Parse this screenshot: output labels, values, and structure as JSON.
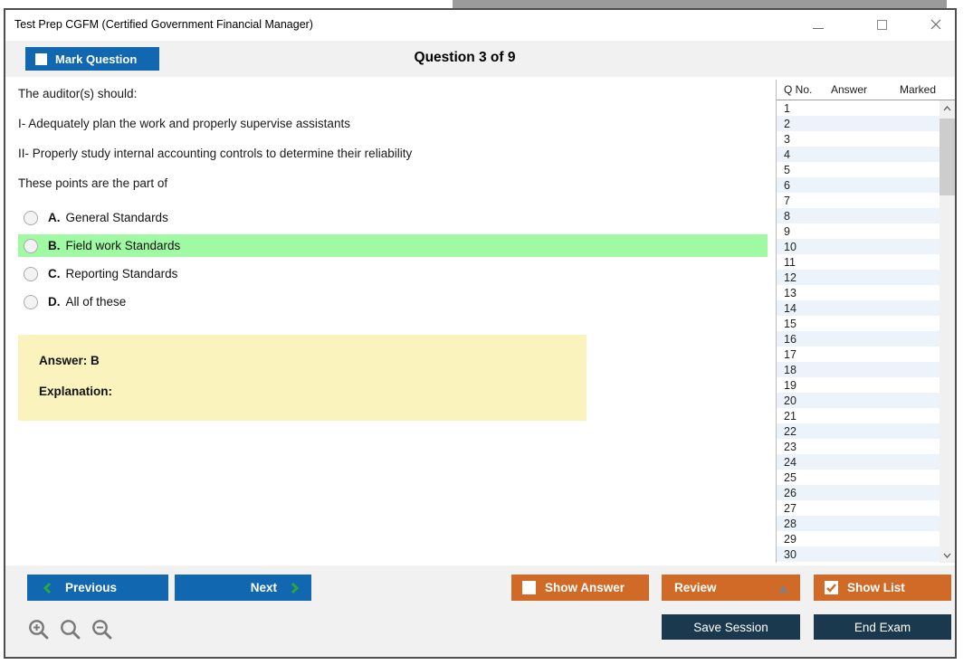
{
  "window": {
    "title": "Test Prep CGFM (Certified Government Financial Manager)"
  },
  "header": {
    "mark_question": "Mark Question",
    "mark_question_checked": false,
    "question_counter": "Question 3 of 9"
  },
  "question": {
    "lines": [
      "The auditor(s) should:",
      "I- Adequately plan the work and properly supervise assistants",
      "II- Properly study internal accounting controls to determine their reliability",
      "These points are the part of"
    ],
    "options": [
      {
        "letter": "A.",
        "text": "General Standards",
        "highlighted": false
      },
      {
        "letter": "B.",
        "text": "Field work Standards",
        "highlighted": true
      },
      {
        "letter": "C.",
        "text": "Reporting Standards",
        "highlighted": false
      },
      {
        "letter": "D.",
        "text": "All of these",
        "highlighted": false
      }
    ],
    "answer": "Answer: B",
    "explanation": "Explanation:"
  },
  "question_list": {
    "columns": [
      "Q No.",
      "Answer",
      "Marked"
    ],
    "rows": [
      {
        "q_no": "1",
        "answer": "",
        "marked": ""
      },
      {
        "q_no": "2",
        "answer": "",
        "marked": ""
      },
      {
        "q_no": "3",
        "answer": "",
        "marked": ""
      },
      {
        "q_no": "4",
        "answer": "",
        "marked": ""
      },
      {
        "q_no": "5",
        "answer": "",
        "marked": ""
      },
      {
        "q_no": "6",
        "answer": "",
        "marked": ""
      },
      {
        "q_no": "7",
        "answer": "",
        "marked": ""
      },
      {
        "q_no": "8",
        "answer": "",
        "marked": ""
      },
      {
        "q_no": "9",
        "answer": "",
        "marked": ""
      },
      {
        "q_no": "10",
        "answer": "",
        "marked": ""
      },
      {
        "q_no": "11",
        "answer": "",
        "marked": ""
      },
      {
        "q_no": "12",
        "answer": "",
        "marked": ""
      },
      {
        "q_no": "13",
        "answer": "",
        "marked": ""
      },
      {
        "q_no": "14",
        "answer": "",
        "marked": ""
      },
      {
        "q_no": "15",
        "answer": "",
        "marked": ""
      },
      {
        "q_no": "16",
        "answer": "",
        "marked": ""
      },
      {
        "q_no": "17",
        "answer": "",
        "marked": ""
      },
      {
        "q_no": "18",
        "answer": "",
        "marked": ""
      },
      {
        "q_no": "19",
        "answer": "",
        "marked": ""
      },
      {
        "q_no": "20",
        "answer": "",
        "marked": ""
      },
      {
        "q_no": "21",
        "answer": "",
        "marked": ""
      },
      {
        "q_no": "22",
        "answer": "",
        "marked": ""
      },
      {
        "q_no": "23",
        "answer": "",
        "marked": ""
      },
      {
        "q_no": "24",
        "answer": "",
        "marked": ""
      },
      {
        "q_no": "25",
        "answer": "",
        "marked": ""
      },
      {
        "q_no": "26",
        "answer": "",
        "marked": ""
      },
      {
        "q_no": "27",
        "answer": "",
        "marked": ""
      },
      {
        "q_no": "28",
        "answer": "",
        "marked": ""
      },
      {
        "q_no": "29",
        "answer": "",
        "marked": ""
      },
      {
        "q_no": "30",
        "answer": "",
        "marked": ""
      }
    ]
  },
  "footer": {
    "previous": "Previous",
    "next": "Next",
    "show_answer": "Show Answer",
    "show_answer_checked": false,
    "review": "Review",
    "show_list": "Show List",
    "show_list_checked": true,
    "save_session": "Save Session",
    "end_exam": "End Exam"
  },
  "colors": {
    "primary_blue": "#1168B0",
    "orange": "#D06A26",
    "dark_navy": "#1B394E",
    "highlight_green": "#A0FAA4",
    "answer_yellow": "#FBF3BD",
    "row_alt_blue": "#EDF3FA",
    "chevron_green": "#2FA83B"
  }
}
